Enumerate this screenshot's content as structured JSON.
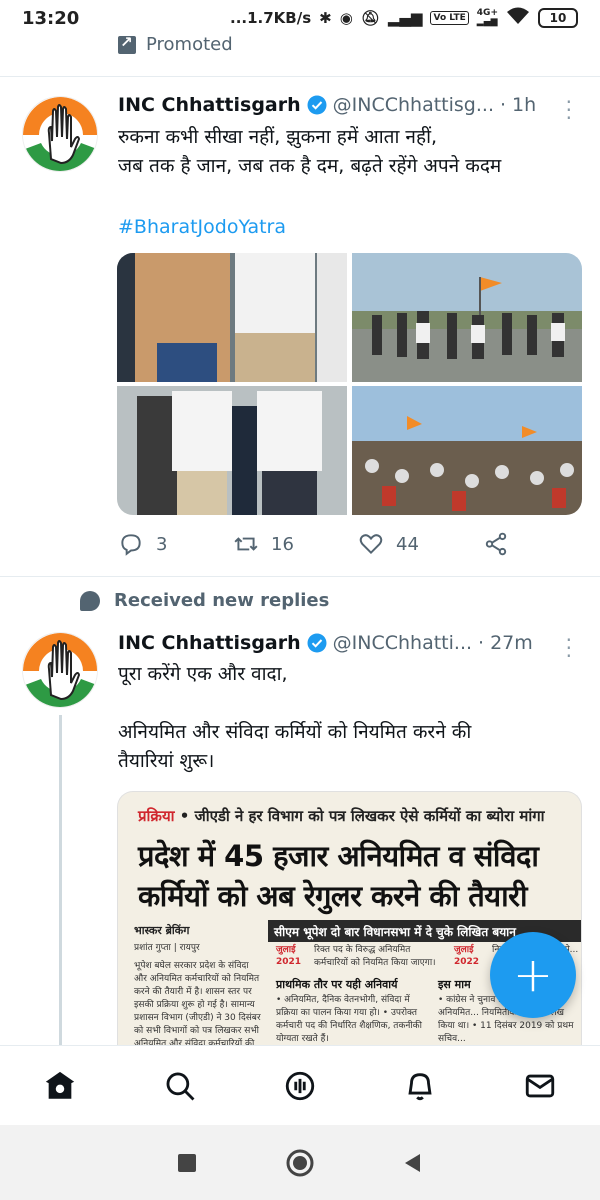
{
  "status_bar": {
    "time": "13:20",
    "network_speed": "...1.7KB/s",
    "signal_4g": "4G+",
    "volte": "Vo LTE",
    "battery": "10"
  },
  "promoted": {
    "label": "Promoted",
    "icon": "promoted-arrow-icon"
  },
  "tweets": [
    {
      "name": "INC Chhattisgarh",
      "handle": "@INCChhattisg...",
      "dot": "·",
      "time": "1h",
      "text_line1": "रुकना कभी सीखा नहीं, झुकना हमें आता नहीं,",
      "text_line2": "जब तक है जान, जब तक है दम, बढ़ते रहेंगे अपने कदम",
      "hashtag": "#BharatJodoYatra",
      "replies": "3",
      "retweets": "16",
      "likes": "44"
    },
    {
      "name": "INC Chhattisgarh",
      "handle": "@INCChhatti...",
      "dot": "·",
      "time": "27m",
      "text_line1": "पूरा करेंगे एक और वादा,",
      "text_line2": "अनियमित और संविदा कर्मियों को नियमित करने की",
      "text_line3": "तैयारियां शुरू।"
    }
  ],
  "received_new_replies": "Received new replies",
  "news_clip": {
    "kicker_red": "प्रक्रिया",
    "kicker": " • जीएडी ने हर विभाग को पत्र लिखकर ऐसे कर्मियों का ब्योरा मांगा",
    "headline1": "प्रदेश में 45 हजार अनियमित व संविदा",
    "headline2": "कर्मियों को अब रेगुलर करने की तैयारी",
    "subbar": "सीएम भूपेश दो बार विधानसभा में दे चुके लिखित बयान",
    "brand": "भास्कर ब्रेकिंग",
    "byline": "प्रशांत गुप्ता | रायपुर",
    "col1": "भूपेश बघेल सरकार प्रदेश के संविदा और अनियमित कर्मचारियों को नियमित करने की तैयारी में है। शासन स्तर पर इसकी प्रक्रिया शुरू हो गई है। सामान्य प्रशासन विभाग (जीएडी) ने 30 दिसंबर को सभी विभागों को पत्र लिखकर सभी अनियमित और संविदा कर्मचारियों की जानकारी मांगी है।",
    "july2021_label": "जुलाई",
    "july2021_year": "2021",
    "july2021_text": "रिक्त पद के विरुद्ध अनियमित कर्मचारियों को नियमित किया जाएगा।",
    "july2022_label": "जुलाई",
    "july2022_year": "2022",
    "july2022_text": "नियमितीकरण विभाग से...",
    "col2_head": "प्राथमिक तौर पर यही अनिवार्य",
    "col2": "• अनियमित, दैनिक वेतनभोगी, संविदा में प्रक्रिया का पालन किया गया हो। • उपरोक्त कर्मचारी पद की निर्धारित शैक्षणिक, तकनीकी योग्यता रखते हैं।",
    "col3_head": "इस माम",
    "col3": "• कांग्रेस ने चुनाव 20... में राज्य के अनियमित... नियमितीकरण का उल्लेख किया था। • 11 दिसंबर 2019 को प्रथम सचिव..."
  },
  "bottom_nav": [
    "home-icon",
    "search-icon",
    "spaces-icon",
    "notifications-icon",
    "messages-icon"
  ],
  "compose": "+"
}
